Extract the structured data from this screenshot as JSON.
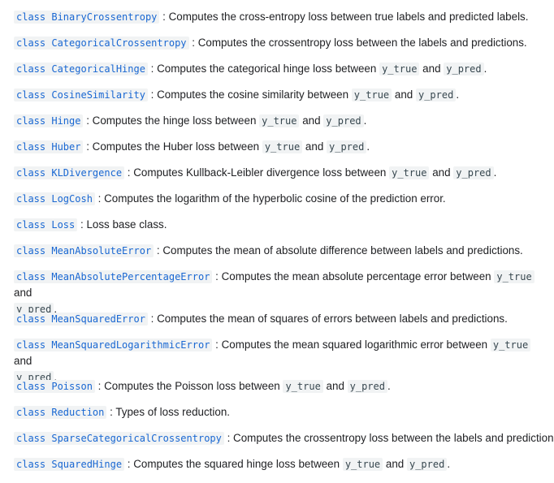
{
  "keyword": "class",
  "args": {
    "y_true": "y_true",
    "y_pred": "y_pred"
  },
  "entries": [
    {
      "name": "BinaryCrossentropy",
      "desc": "Computes the cross-entropy loss between true labels and predicted labels."
    },
    {
      "name": "CategoricalCrossentropy",
      "desc": "Computes the crossentropy loss between the labels and predictions."
    },
    {
      "name": "CategoricalHinge",
      "desc_pre": "Computes the categorical hinge loss between",
      "desc_mid": "and",
      "desc_end": "."
    },
    {
      "name": "CosineSimilarity",
      "desc_pre": "Computes the cosine similarity between",
      "desc_mid": "and",
      "desc_end": "."
    },
    {
      "name": "Hinge",
      "desc_pre": "Computes the hinge loss between",
      "desc_mid": "and",
      "desc_end": "."
    },
    {
      "name": "Huber",
      "desc_pre": "Computes the Huber loss between",
      "desc_mid": "and",
      "desc_end": "."
    },
    {
      "name": "KLDivergence",
      "desc_pre": "Computes Kullback-Leibler divergence loss between",
      "desc_mid": "and",
      "desc_end": "."
    },
    {
      "name": "LogCosh",
      "desc": "Computes the logarithm of the hyperbolic cosine of the prediction error."
    },
    {
      "name": "Loss",
      "desc": "Loss base class."
    },
    {
      "name": "MeanAbsoluteError",
      "desc": "Computes the mean of absolute difference between labels and predictions."
    },
    {
      "name": "MeanAbsolutePercentageError",
      "desc_pre": "Computes the mean absolute percentage error between",
      "desc_mid": "and",
      "desc_end": "."
    },
    {
      "name": "MeanSquaredError",
      "desc": "Computes the mean of squares of errors between labels and predictions."
    },
    {
      "name": "MeanSquaredLogarithmicError",
      "desc_pre": "Computes the mean squared logarithmic error between",
      "desc_mid": "and",
      "desc_end": "."
    },
    {
      "name": "Poisson",
      "desc_pre": "Computes the Poisson loss between",
      "desc_mid": "and",
      "desc_end": "."
    },
    {
      "name": "Reduction",
      "desc": "Types of loss reduction."
    },
    {
      "name": "SparseCategoricalCrossentropy",
      "desc": "Computes the crossentropy loss between the labels and predictions."
    },
    {
      "name": "SquaredHinge",
      "desc_pre": "Computes the squared hinge loss between",
      "desc_mid": "and",
      "desc_end": "."
    }
  ]
}
